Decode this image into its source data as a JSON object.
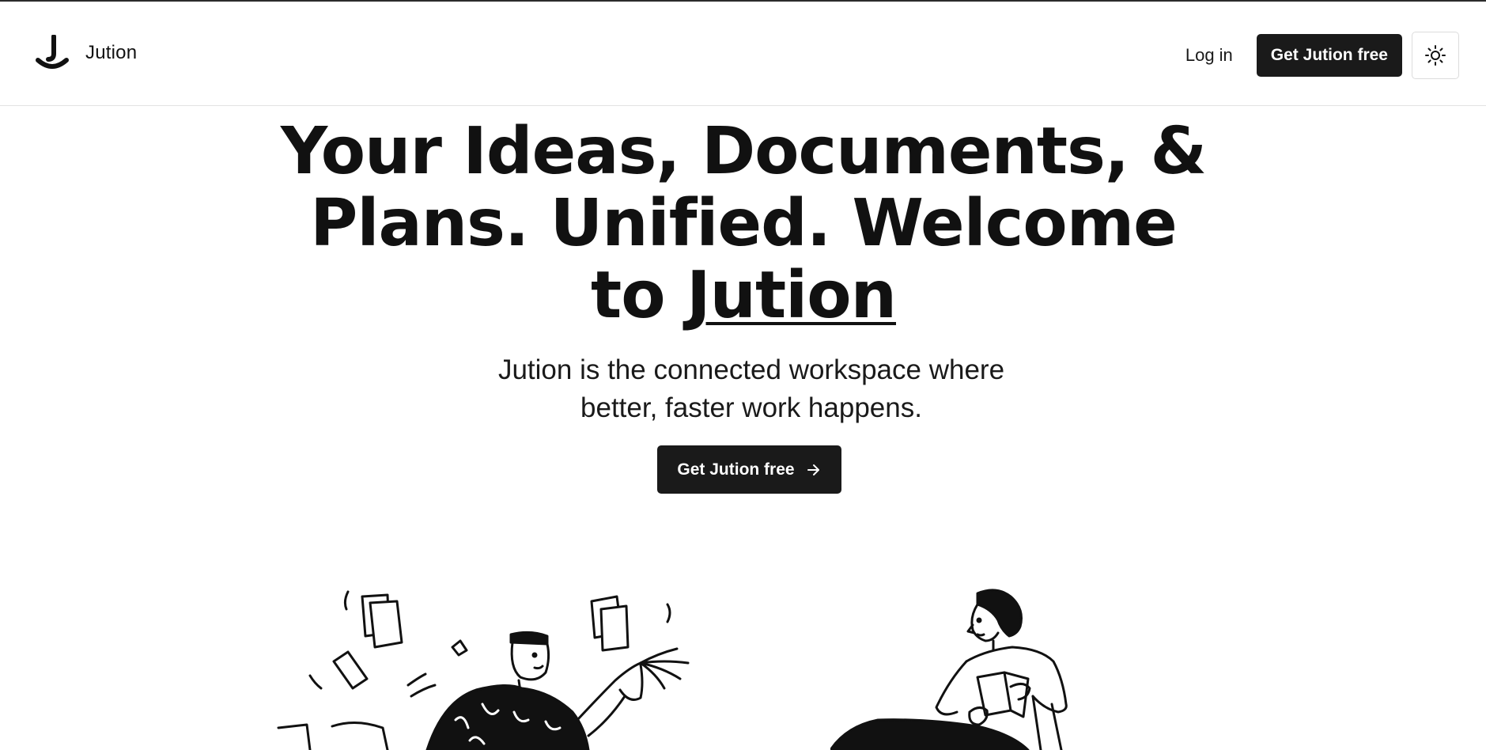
{
  "brand": {
    "name": "Jution",
    "logo_icon": "jution-logo-icon"
  },
  "nav": {
    "login_label": "Log in",
    "cta_label": "Get Jution free",
    "theme_toggle_icon": "sun-icon"
  },
  "hero": {
    "title_line1": "Your Ideas, Documents, &",
    "title_line2": "Plans. Unified. Welcome",
    "title_line3_prefix": "to ",
    "title_line3_brand": "Jution",
    "subtitle_line1": "Jution is the connected workspace where",
    "subtitle_line2": "better, faster work happens.",
    "cta_label": "Get Jution free",
    "cta_icon": "arrow-right-icon"
  },
  "illustrations": {
    "left": "man-juggling-papers-illustration",
    "right": "woman-reading-illustration"
  },
  "colors": {
    "text": "#111111",
    "button_bg": "#1a1a1a",
    "button_text": "#ffffff",
    "border": "#e3e3e3",
    "background": "#ffffff"
  }
}
